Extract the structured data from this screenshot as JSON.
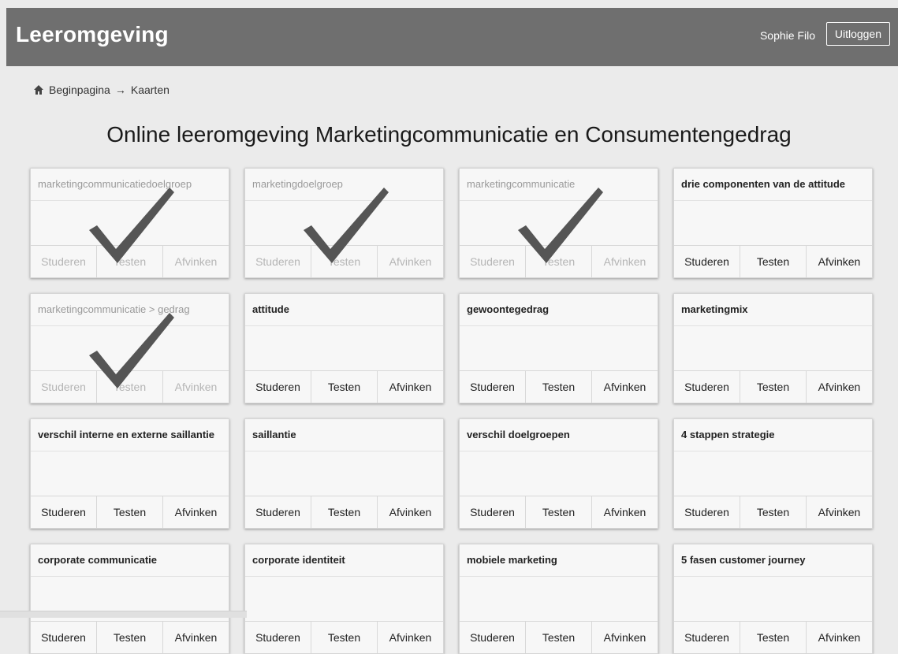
{
  "header": {
    "brand": "Leeromgeving",
    "user_name": "Sophie Filo",
    "logout_label": "Uitloggen"
  },
  "breadcrumb": {
    "home": "Beginpagina",
    "separator": "→",
    "current": "Kaarten"
  },
  "page_title": "Online leeromgeving Marketingcommunicatie en Consumentengedrag",
  "card_actions": {
    "study": "Studeren",
    "test": "Testen",
    "check_off": "Afvinken"
  },
  "cards": [
    {
      "title": "marketingcommunicatiedoelgroep",
      "completed": true
    },
    {
      "title": "marketingdoelgroep",
      "completed": true
    },
    {
      "title": "marketingcommunicatie",
      "completed": true
    },
    {
      "title": "drie componenten van de attitude",
      "completed": false
    },
    {
      "title": "marketingcommunicatie > gedrag",
      "completed": true
    },
    {
      "title": "attitude",
      "completed": false
    },
    {
      "title": "gewoontegedrag",
      "completed": false
    },
    {
      "title": "marketingmix",
      "completed": false
    },
    {
      "title": "verschil interne en externe saillantie",
      "completed": false
    },
    {
      "title": "saillantie",
      "completed": false
    },
    {
      "title": "verschil doelgroepen",
      "completed": false
    },
    {
      "title": "4 stappen strategie",
      "completed": false
    },
    {
      "title": "corporate communicatie",
      "completed": false
    },
    {
      "title": "corporate identiteit",
      "completed": false
    },
    {
      "title": "mobiele marketing",
      "completed": false
    },
    {
      "title": "5 fasen customer journey",
      "completed": false
    }
  ],
  "colors": {
    "header_bg": "#6f6f6f",
    "page_bg": "#ebebeb",
    "card_bg": "#f7f7f7",
    "checkmark": "#555555"
  }
}
